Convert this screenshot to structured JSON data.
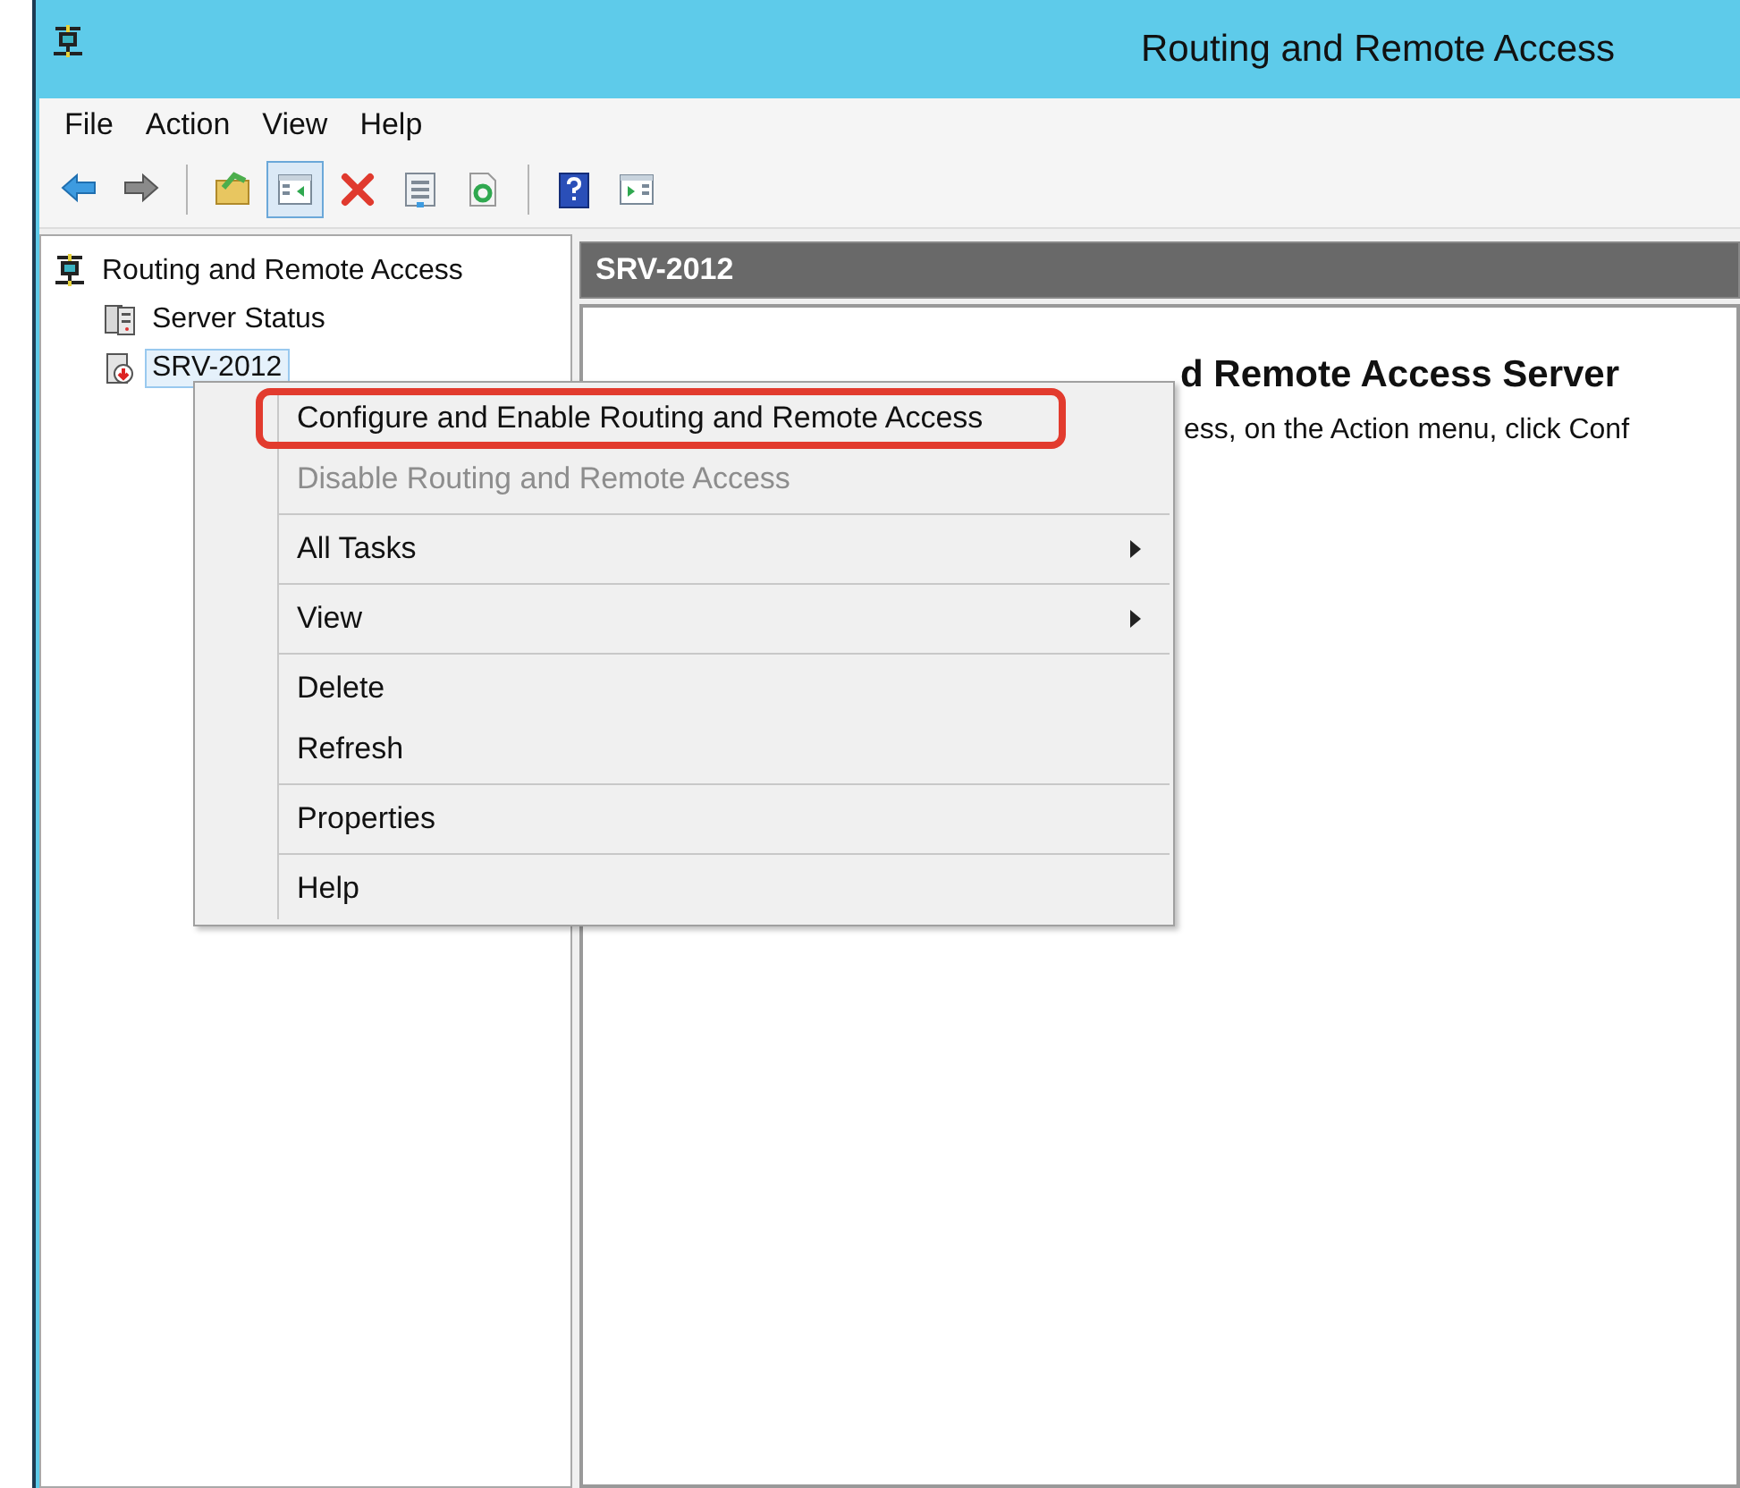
{
  "window": {
    "title": "Routing and Remote Access"
  },
  "menu_bar": [
    "File",
    "Action",
    "View",
    "Help"
  ],
  "toolbar": [
    {
      "kind": "back",
      "pressed": false
    },
    {
      "kind": "forward",
      "pressed": false
    },
    {
      "kind": "separator"
    },
    {
      "kind": "up",
      "pressed": false
    },
    {
      "kind": "tree",
      "pressed": true
    },
    {
      "kind": "delete",
      "pressed": false
    },
    {
      "kind": "properties",
      "pressed": false
    },
    {
      "kind": "refresh",
      "pressed": false
    },
    {
      "kind": "separator"
    },
    {
      "kind": "help",
      "pressed": false
    },
    {
      "kind": "actionpane",
      "pressed": false
    }
  ],
  "tree": [
    {
      "label": "Routing and Remote Access",
      "kind": "root",
      "selected": false,
      "children": [
        {
          "label": "Server Status",
          "kind": "status",
          "selected": false
        },
        {
          "label": "SRV-2012",
          "kind": "server",
          "selected": true
        }
      ]
    }
  ],
  "details": {
    "header": "SRV-2012",
    "heading": "d Remote Access Server",
    "text": "ess, on the Action menu, click Conf"
  },
  "context_menu": [
    {
      "kind": "item",
      "label": "Configure and Enable Routing and Remote Access",
      "disabled": false,
      "submenu": false,
      "highlighted": true
    },
    {
      "kind": "item",
      "label": "Disable Routing and Remote Access",
      "disabled": true,
      "submenu": false,
      "highlighted": false
    },
    {
      "kind": "separator"
    },
    {
      "kind": "item",
      "label": "All Tasks",
      "disabled": false,
      "submenu": true,
      "highlighted": false
    },
    {
      "kind": "separator"
    },
    {
      "kind": "item",
      "label": "View",
      "disabled": false,
      "submenu": true,
      "highlighted": false
    },
    {
      "kind": "separator"
    },
    {
      "kind": "item",
      "label": "Delete",
      "disabled": false,
      "submenu": false,
      "highlighted": false
    },
    {
      "kind": "item",
      "label": "Refresh",
      "disabled": false,
      "submenu": false,
      "highlighted": false
    },
    {
      "kind": "separator"
    },
    {
      "kind": "item",
      "label": "Properties",
      "disabled": false,
      "submenu": false,
      "highlighted": false
    },
    {
      "kind": "separator"
    },
    {
      "kind": "item",
      "label": "Help",
      "disabled": false,
      "submenu": false,
      "highlighted": false
    }
  ]
}
